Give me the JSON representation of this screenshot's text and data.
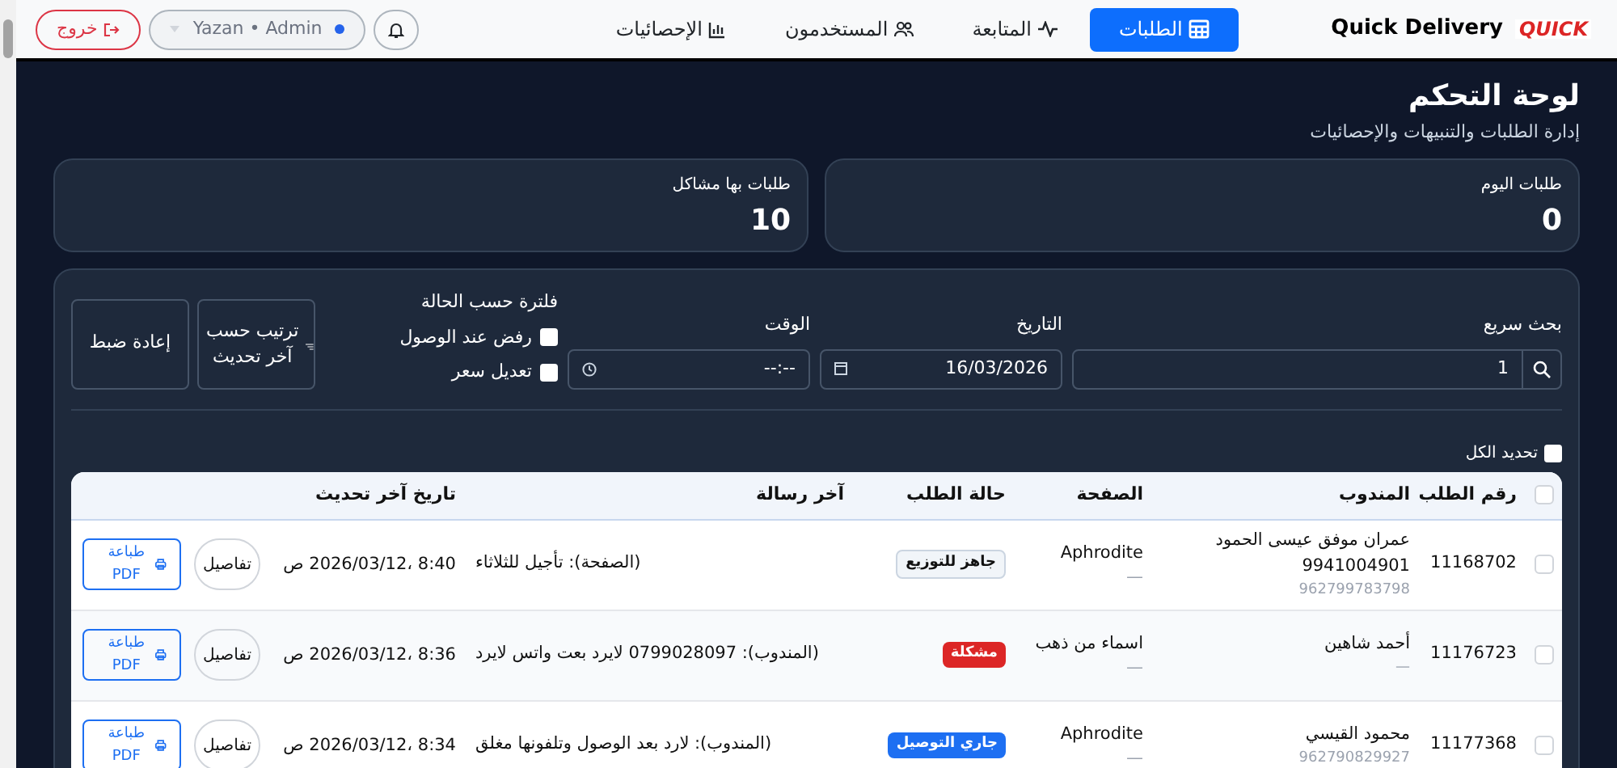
{
  "navbar": {
    "logo_text": "QUICK",
    "brand": "Quick Delivery",
    "tabs": [
      {
        "label": "الطلبات",
        "selected": true
      },
      {
        "label": "المتابعة",
        "selected": false
      },
      {
        "label": "المستخدمون",
        "selected": false
      },
      {
        "label": "الإحصائيات",
        "selected": false
      }
    ],
    "user": "Yazan • Admin",
    "logout": "خروج"
  },
  "header": {
    "title": "لوحة التحكم",
    "subtitle": "إدارة الطلبات والتنبيهات والإحصائيات"
  },
  "stats": [
    {
      "label": "طلبات اليوم",
      "value": "0"
    },
    {
      "label": "طلبات بها مشاكل",
      "value": "10"
    }
  ],
  "filters": {
    "search": {
      "label": "بحث سريع",
      "value": "1"
    },
    "date": {
      "label": "التاريخ",
      "value": "16/03/2026"
    },
    "time": {
      "label": "الوقت",
      "value": "--:--"
    },
    "status_filter": {
      "label": "فلترة حسب الحالة",
      "options": [
        {
          "label": "رفض عند الوصول",
          "checked": false
        },
        {
          "label": "تعديل سعر",
          "checked": false
        }
      ]
    },
    "sort_button": "ترتيب حسب آخر تحديث",
    "reset_button": "إعادة ضبط"
  },
  "select_all": {
    "label": "تحديد الكل",
    "checked": false
  },
  "table": {
    "header_checked": false,
    "columns": [
      "رقم الطلب",
      "المندوب",
      "الصفحة",
      "حالة الطلب",
      "آخر رسالة",
      "تاريخ آخر تحديث"
    ],
    "rows": [
      {
        "checked": false,
        "order": "11168702",
        "courier": "عمران موفق عيسى الحمود 9941004901",
        "phone": "962799783798",
        "page": "Aphrodite",
        "page_sub": "—",
        "status": {
          "label": "جاهز للتوزيع",
          "kind": "ready"
        },
        "message": "(الصفحة): تأجيل للثلاثاء",
        "updated": "8:40 ،2026/03/12 ص",
        "details": "تفاصيل",
        "print": "طباعة PDF"
      },
      {
        "checked": false,
        "order": "11176723",
        "courier": "أحمد شاهين",
        "phone": "—",
        "page": "اسماء من ذهب",
        "page_sub": "—",
        "status": {
          "label": "مشكلة",
          "kind": "problem"
        },
        "message": "(المندوب): 0799028097 لايرد بعت واتس لايرد",
        "updated": "8:36 ،2026/03/12 ص",
        "details": "تفاصيل",
        "print": "طباعة PDF"
      },
      {
        "checked": false,
        "order": "11177368",
        "courier": "محمود القيسي",
        "phone": "962790829927",
        "page": "Aphrodite",
        "page_sub": "—",
        "status": {
          "label": "جاري التوصيل",
          "kind": "delivering"
        },
        "message": "(المندوب): لارد بعد الوصول وتلفونها مغلق",
        "updated": "8:34 ،2026/03/12 ص",
        "details": "تفاصيل",
        "print": "طباعة PDF"
      }
    ]
  }
}
